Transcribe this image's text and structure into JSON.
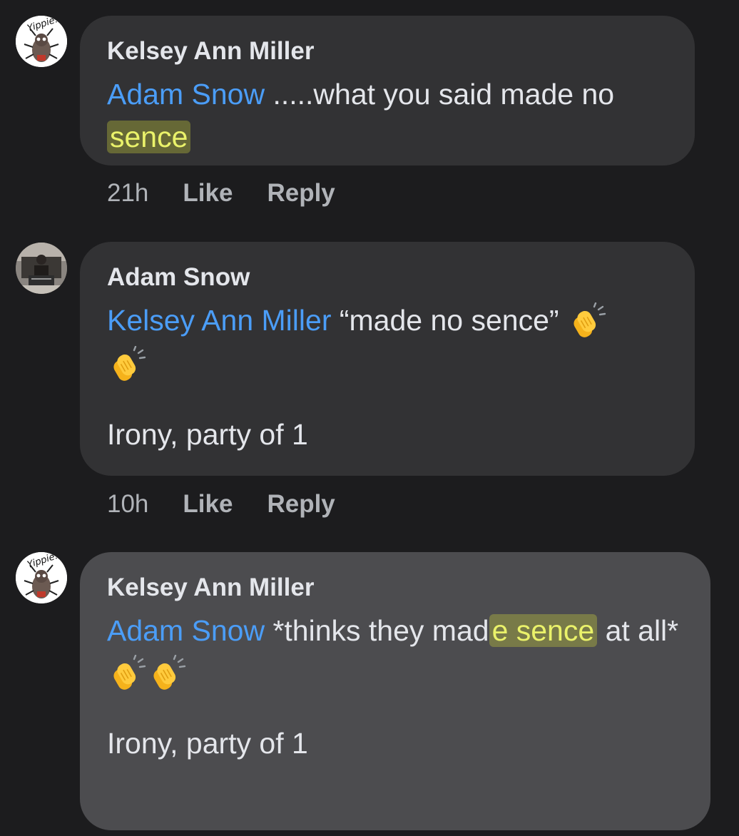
{
  "comments": [
    {
      "author": "Kelsey Ann Miller",
      "mention": "Adam Snow",
      "text_before": " .....what you said made no ",
      "highlight": "sence",
      "text_after": "",
      "time": "21h",
      "like_label": "Like",
      "reply_label": "Reply",
      "avatar_text": "Yippie!"
    },
    {
      "author": "Adam Snow",
      "mention": "Kelsey Ann Miller",
      "text_before": " “made no sence” ",
      "emoji": "clapping-hands",
      "followup": "Irony, party of 1",
      "time": "10h",
      "like_label": "Like",
      "reply_label": "Reply"
    },
    {
      "author": "Kelsey Ann Miller",
      "mention": "Adam Snow",
      "text_before": " *thinks they mad",
      "highlight": "e sence",
      "text_after": " at all*",
      "emoji": "clapping-hands",
      "emoji_count": 2,
      "followup": "Irony, party of 1",
      "avatar_text": "Yippie!"
    }
  ],
  "colors": {
    "background": "#1c1c1e",
    "bubble": "#323234",
    "bubble_selected": "#4c4c4f",
    "mention": "#4b9df7",
    "highlight": "#eaf26a",
    "meta": "#b0b3b8"
  }
}
